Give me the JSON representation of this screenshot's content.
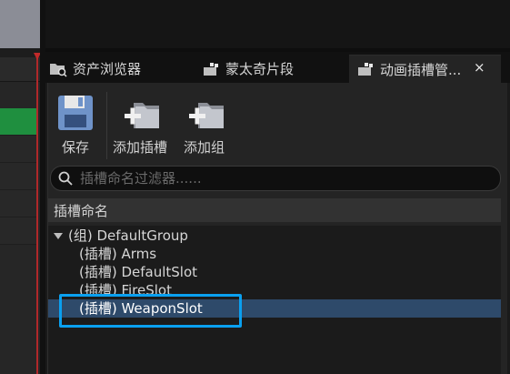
{
  "tabs": [
    {
      "label": "资产浏览器",
      "icon": "folder-search-icon",
      "active": false
    },
    {
      "label": "蒙太奇片段",
      "icon": "montage-icon",
      "active": false
    },
    {
      "label": "动画插槽管...",
      "icon": "anim-slot-icon",
      "active": true
    }
  ],
  "tab_close_glyph": "×",
  "toolbar": {
    "save_label": "保存",
    "add_slot_label": "添加插槽",
    "add_group_label": "添加组"
  },
  "search": {
    "placeholder": "插槽命名过滤器......",
    "value": ""
  },
  "list": {
    "header": "插槽命名",
    "group": {
      "label": "(组) DefaultGroup",
      "expanded": true
    },
    "slots": [
      {
        "label": "(插槽) Arms",
        "selected": false
      },
      {
        "label": "(插槽) DefaultSlot",
        "selected": false
      },
      {
        "label": "(插槽) FireSlot",
        "selected": false
      },
      {
        "label": "(插槽) WeaponSlot",
        "selected": true
      }
    ]
  },
  "colors": {
    "accent_highlight": "#0aa0f0",
    "selection": "#2e4a6a",
    "timeline_marker": "#b0282a",
    "track_green": "#1f8f3f"
  }
}
